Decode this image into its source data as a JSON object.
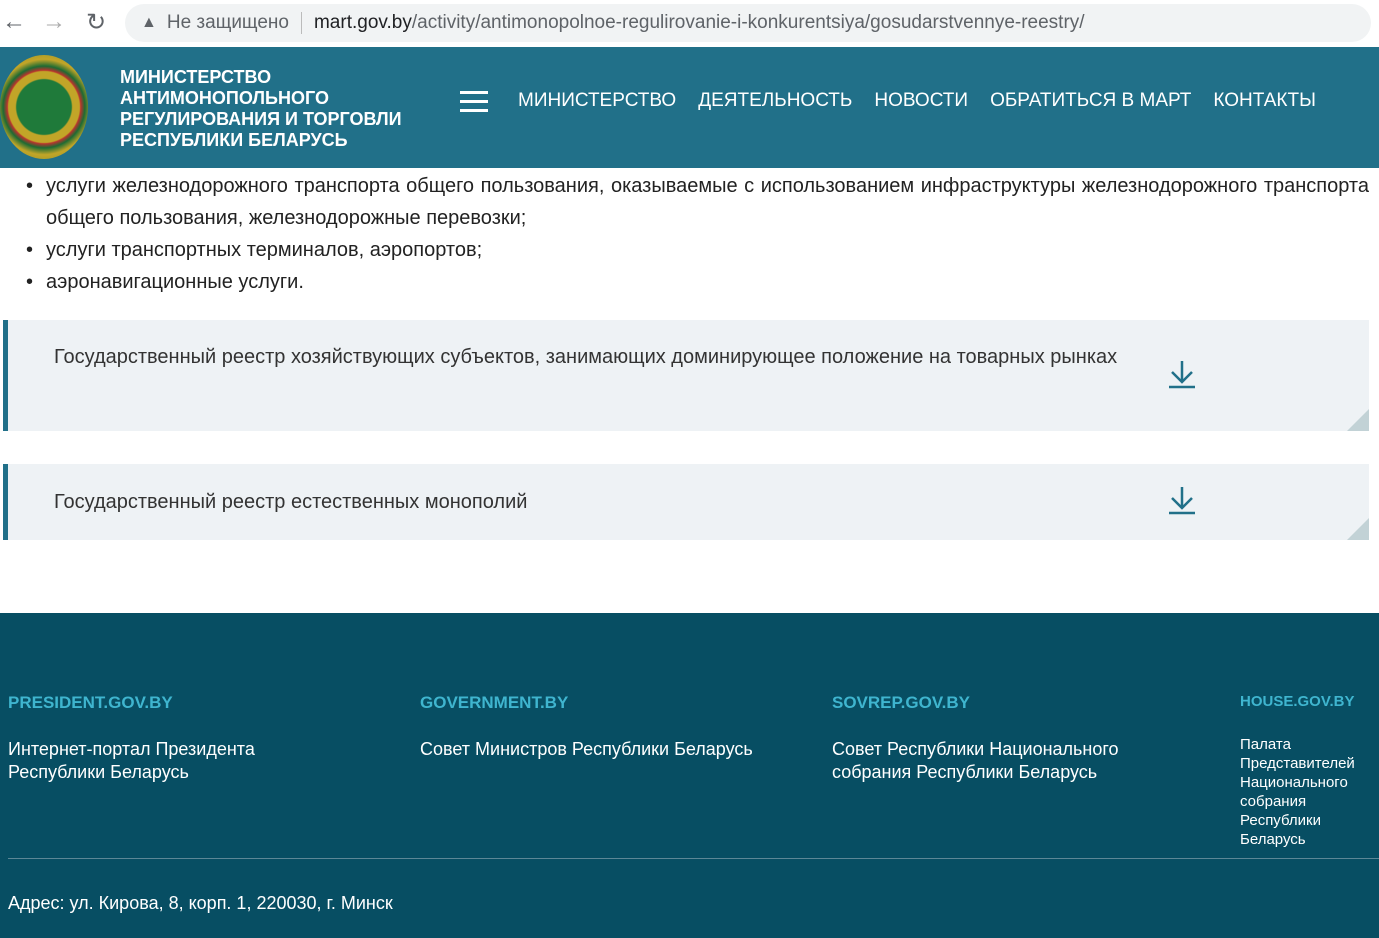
{
  "browser": {
    "security": "Не защищено",
    "host": "mart.gov.by",
    "path": "/activity/antimonopolnoe-regulirovanie-i-konkurentsiya/gosudarstvennye-reestry/"
  },
  "header": {
    "title_lines": [
      "МИНИСТЕРСТВО",
      "АНТИМОНОПОЛЬНОГО",
      "РЕГУЛИРОВАНИЯ И ТОРГОВЛИ",
      "РЕСПУБЛИКИ БЕЛАРУСЬ"
    ],
    "nav": [
      "МИНИСТЕРСТВО",
      "ДЕЯТЕЛЬНОСТЬ",
      "НОВОСТИ",
      "ОБРАТИТЬСЯ В МАРТ",
      "КОНТАКТЫ"
    ]
  },
  "content": {
    "bullets": [
      "услуги железнодорожного транспорта общего пользования, оказываемые с использованием инфраструктуры железнодорожного транспорта общего пользования, железнодорожные перевозки;",
      "услуги транспортных терминалов, аэропортов;",
      "аэронавигационные услуги."
    ],
    "accordions": [
      "Государственный реестр хозяйствующих субъектов, занимающих доминирующее положение на товарных рынках",
      "Государственный реестр естественных монополий"
    ]
  },
  "footer": {
    "links": [
      {
        "title": "PRESIDENT.GOV.BY",
        "desc": "Интернет-портал Президента Республики Беларусь"
      },
      {
        "title": "GOVERNMENT.BY",
        "desc": "Совет Министров Республики Беларусь"
      },
      {
        "title": "SOVREP.GOV.BY",
        "desc": "Совет Республики Национального собрания Республики Беларусь"
      },
      {
        "title": "HOUSE.GOV.BY",
        "desc": "Палата Представителей Национального собрания Республики Беларусь"
      }
    ],
    "address": "Адрес: ул. Кирова,  8, корп. 1, 220030, г. Минск"
  }
}
